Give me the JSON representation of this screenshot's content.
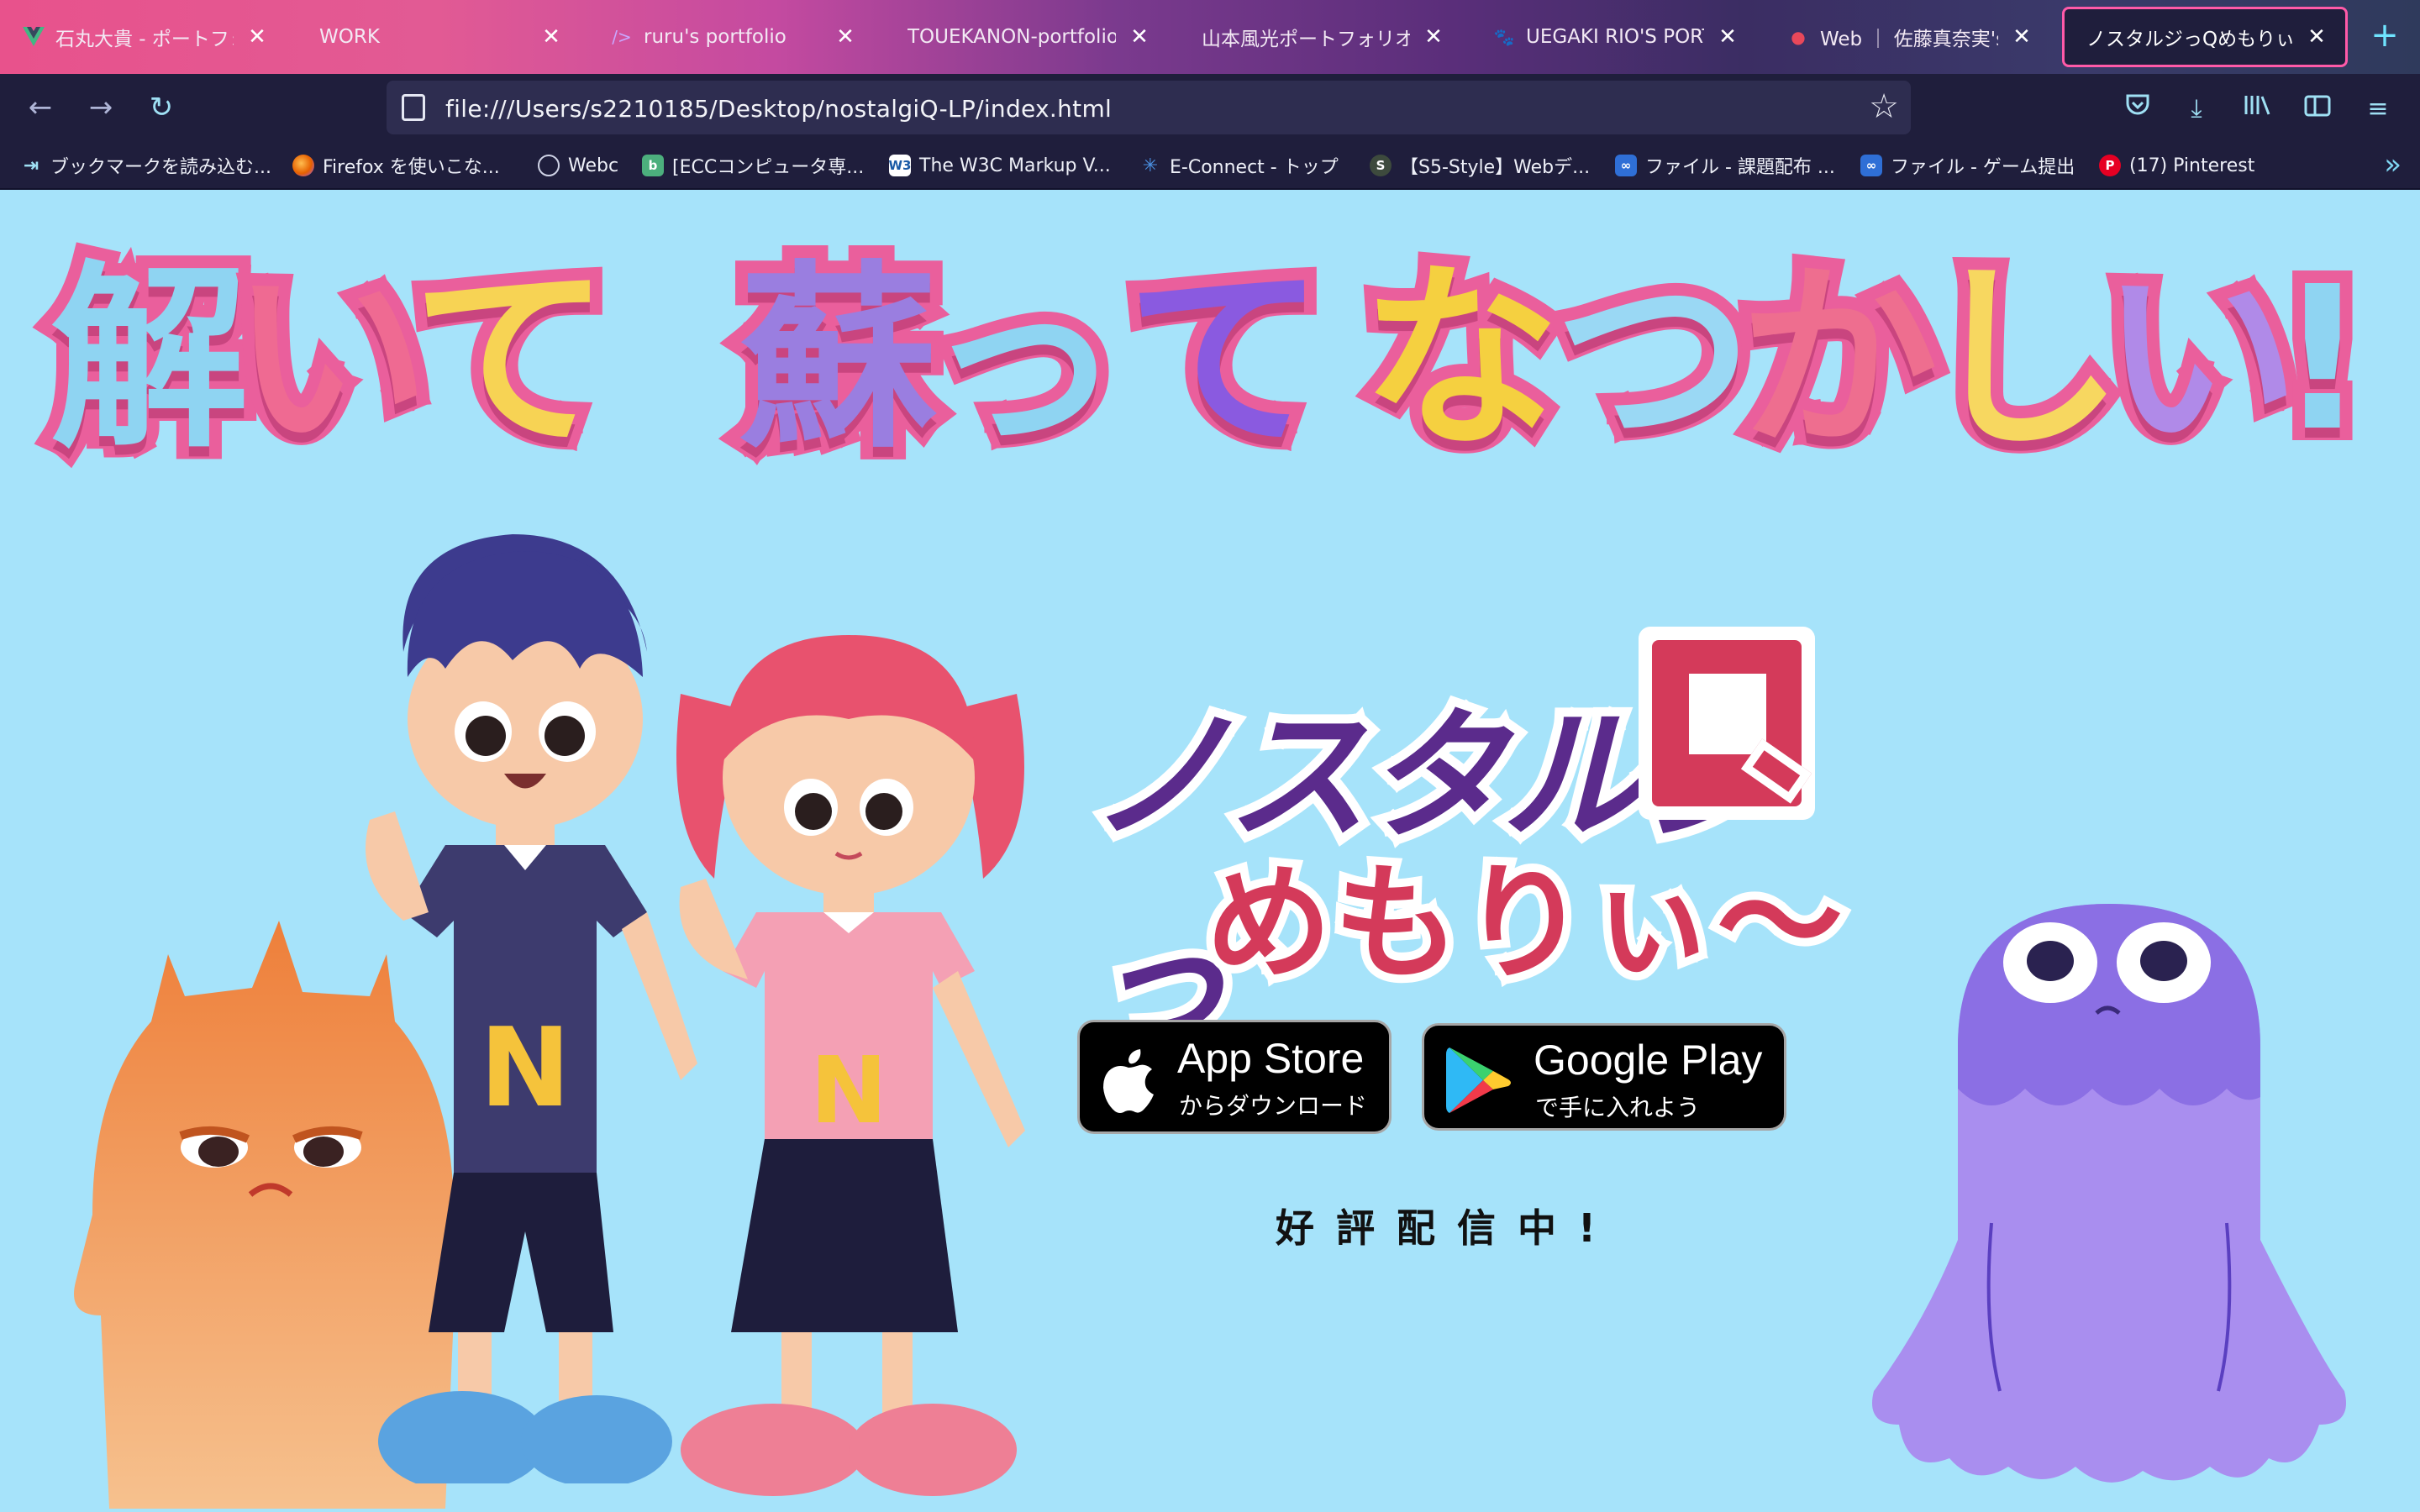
{
  "browser": {
    "tabs": [
      {
        "title": "石丸大貴 - ポートフォリ",
        "favicon": "vue-icon",
        "active": false
      },
      {
        "title": "WORK",
        "favicon": "",
        "active": false
      },
      {
        "title": "ruru's portfolio",
        "favicon": "code-icon",
        "active": false
      },
      {
        "title": "TOUEKANON-portfolio-",
        "favicon": "",
        "active": false
      },
      {
        "title": "山本風光ポートフォリオサイ",
        "favicon": "",
        "active": false
      },
      {
        "title": "UEGAKI RIO'S PORTFC",
        "favicon": "cat-icon",
        "active": false
      },
      {
        "title": "Web ｜ 佐藤真奈実's P",
        "favicon": "strawberry-icon",
        "active": false
      },
      {
        "title": "ノスタルジっQめもりぃ",
        "favicon": "",
        "active": true
      }
    ],
    "url": "file:///Users/s2210185/Desktop/nostalgiQ-LP/index.html",
    "bookmarks": [
      {
        "label": "ブックマークを読み込む...",
        "icon": "import-icon",
        "color": "#3a3a6a"
      },
      {
        "label": "Firefox を使いこな...",
        "icon": "firefox-icon",
        "color": "#e66000"
      },
      {
        "label": "Webc",
        "icon": "globe-icon",
        "color": "#3a3a6a"
      },
      {
        "label": "[ECCコンピュータ専...",
        "icon": "b-icon",
        "color": "#4caf7d"
      },
      {
        "label": "The W3C Markup V...",
        "icon": "w3c-icon",
        "color": "#ffffff"
      },
      {
        "label": "E-Connect - トップ",
        "icon": "econnect-icon",
        "color": "#3a79c6"
      },
      {
        "label": "【S5-Style】Webデ...",
        "icon": "s-icon",
        "color": "#3d4a3d"
      },
      {
        "label": "ファイル - 課題配布 ...",
        "icon": "cloud-icon",
        "color": "#2f6fd6"
      },
      {
        "label": "ファイル - ゲーム提出",
        "icon": "cloud-icon",
        "color": "#2f6fd6"
      },
      {
        "label": "(17) Pinterest",
        "icon": "pinterest-icon",
        "color": "#e60023"
      }
    ]
  },
  "page": {
    "headline": {
      "chars": [
        "解",
        "い",
        "て",
        "蘇",
        "っ",
        "て",
        "な",
        "つ",
        "か",
        "し",
        "い",
        "!"
      ]
    },
    "logo": {
      "line1": "ノスタルジっ",
      "q": "Q",
      "line2": "めもりぃ〜"
    },
    "app_store": {
      "small": "からダウンロード",
      "big": "App Store"
    },
    "google_play": {
      "small": "で手に入れよう",
      "big": "Google Play"
    },
    "tagline": "好評配信中!",
    "colors": {
      "background": "#a6e3fa",
      "headline_outline": "#ea5f9c",
      "logo_purple": "#5b2b8c",
      "logo_red": "#d43a5a"
    }
  }
}
